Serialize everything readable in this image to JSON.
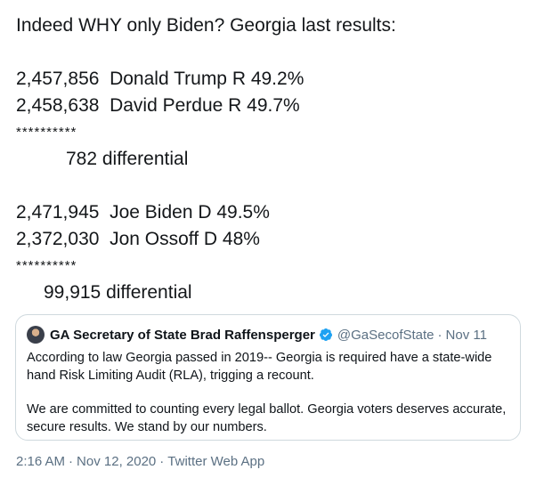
{
  "tweet": {
    "line1": "Indeed WHY only Biden? Georgia last results:",
    "line3": "2,457,856  Donald Trump R 49.2%",
    "line4": "2,458,638  David Perdue R 49.7%",
    "stars1": "**********",
    "diff1": "782 differential",
    "line8": "2,471,945  Joe Biden D 49.5%",
    "line9": "2,372,030  Jon Ossoff D 48%",
    "stars2": "**********",
    "diff2": "99,915 differential"
  },
  "quoted_tweet": {
    "name": "GA Secretary of State Brad Raffensperger",
    "handle": "@GaSecofState",
    "separator": "·",
    "date": "Nov 11",
    "paragraph1": "According to law Georgia passed in 2019-- Georgia is required have a state-wide hand Risk Limiting Audit (RLA), trigging a recount.",
    "paragraph2": "We are committed to counting every legal ballot. Georgia voters deserves accurate, secure results. We stand by our numbers.",
    "verified_icon": "verified-badge-icon",
    "verified_color": "#1da1f2"
  },
  "meta": {
    "time": "2:16 AM",
    "separator": "·",
    "date": "Nov 12, 2020",
    "source": "Twitter Web App"
  }
}
